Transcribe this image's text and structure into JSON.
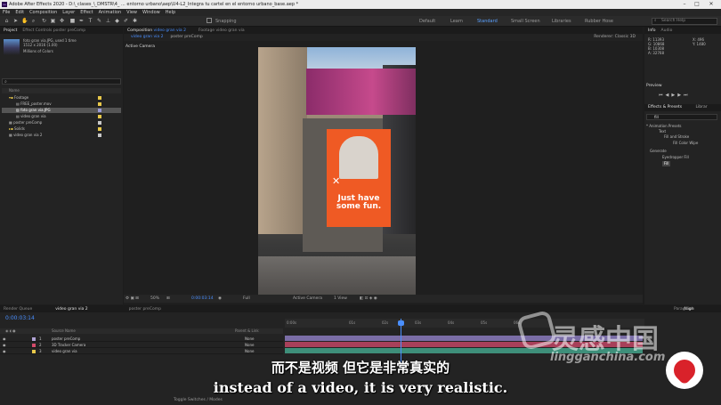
{
  "titlebar": {
    "title": "Adobe After Effects 2020 - D:\\_clases_\\_DMSTR\\4_ ... entorno urbano\\aep\\U4-L2_Integra tu cartel en el entorno urbano_base.aep *",
    "logo": "Ae"
  },
  "menu": [
    "File",
    "Edit",
    "Composition",
    "Layer",
    "Effect",
    "Animation",
    "View",
    "Window",
    "Help"
  ],
  "toolbar": {
    "snapping": "Snapping",
    "workspaces": [
      "Default",
      "Learn",
      "Standard",
      "Small Screen",
      "Libraries",
      "Rubber Hose"
    ],
    "active_workspace": "Standard",
    "search_placeholder": "Search Help"
  },
  "project": {
    "tabs": [
      "Project",
      "Effect Controls poster preComp"
    ],
    "file_name": "foto gran via.JPG",
    "file_used": ", used 1 time",
    "file_dims": "1512 x 2016 (1.00)",
    "file_colors": "Millions of Colors",
    "col_name": "Name",
    "items": [
      {
        "name": "Footage",
        "color": "#e8c84a"
      },
      {
        "name": "FREE_poster.mov",
        "color": "#e8c84a"
      },
      {
        "name": "foto gran via.JPG",
        "color": "#9a9ad8"
      },
      {
        "name": "video gran via",
        "color": "#e8c84a"
      },
      {
        "name": "poster preComp",
        "color": "#c8c8c8"
      },
      {
        "name": "Solids",
        "color": "#e8c84a"
      },
      {
        "name": "video gran via 2",
        "color": "#c8c8c8"
      }
    ]
  },
  "composition": {
    "tab_label": "Composition",
    "tab_name": "video gran via 2",
    "footage_tab": "Footage video gran via",
    "subtabs": [
      "video gran via 2",
      "poster preComp"
    ],
    "renderer_label": "Renderer:",
    "renderer": "Classic 3D",
    "view_label": "Active Camera",
    "poster_text": "Just have some fun.",
    "zoom": "50%",
    "time": "0:00:03:14",
    "resolution": "Full",
    "camera": "Active Camera",
    "views": "1 View"
  },
  "info": {
    "tabs": [
      "Info",
      "Audio"
    ],
    "lines": [
      "R: 11393",
      "G: 10868",
      "B: 10308",
      "A: 32768"
    ],
    "coords": [
      "X: 496",
      "Y: 1480"
    ],
    "preview_tab": "Preview",
    "effects_tab": "Effects & Presets",
    "libraries_tab": "Librar",
    "search_value": "fill",
    "tree": [
      "* Animation Presets",
      "Text",
      "Fill and Stroke",
      "Fill Color Wipe",
      "Generate",
      "Eyedropper Fill",
      "Fill"
    ]
  },
  "timeline": {
    "tabs": [
      "Render Queue",
      "video gran via 2",
      "poster preComp"
    ],
    "timecode": "0:00:03:14",
    "col_source": "Source Name",
    "col_parent": "Parent & Link",
    "ruler_ticks": [
      "0:00s",
      "01s",
      "02s",
      "03s",
      "04s",
      "05s",
      "06s"
    ],
    "layers": [
      {
        "num": "1",
        "name": "poster preComp",
        "parent": "None",
        "color": "#b0a2d4",
        "track": "#7a6da6"
      },
      {
        "num": "2",
        "name": "3D Tracker Camera",
        "parent": "None",
        "color": "#d44a6a",
        "track": "#a8405a"
      },
      {
        "num": "3",
        "name": "video gran via",
        "parent": "None",
        "color": "#e8c84a",
        "track": "#3e8f7a"
      }
    ],
    "toggle_label": "Toggle Switches / Modes",
    "paragraph_tab": "Paragraph",
    "align_tab": "Align"
  },
  "subtitles": {
    "chinese": "而不是视频 但它是非常真实的",
    "english": "instead of a video, it is very realistic."
  },
  "watermark": {
    "brand": "灵感中国",
    "url": "lingganchina.com"
  }
}
